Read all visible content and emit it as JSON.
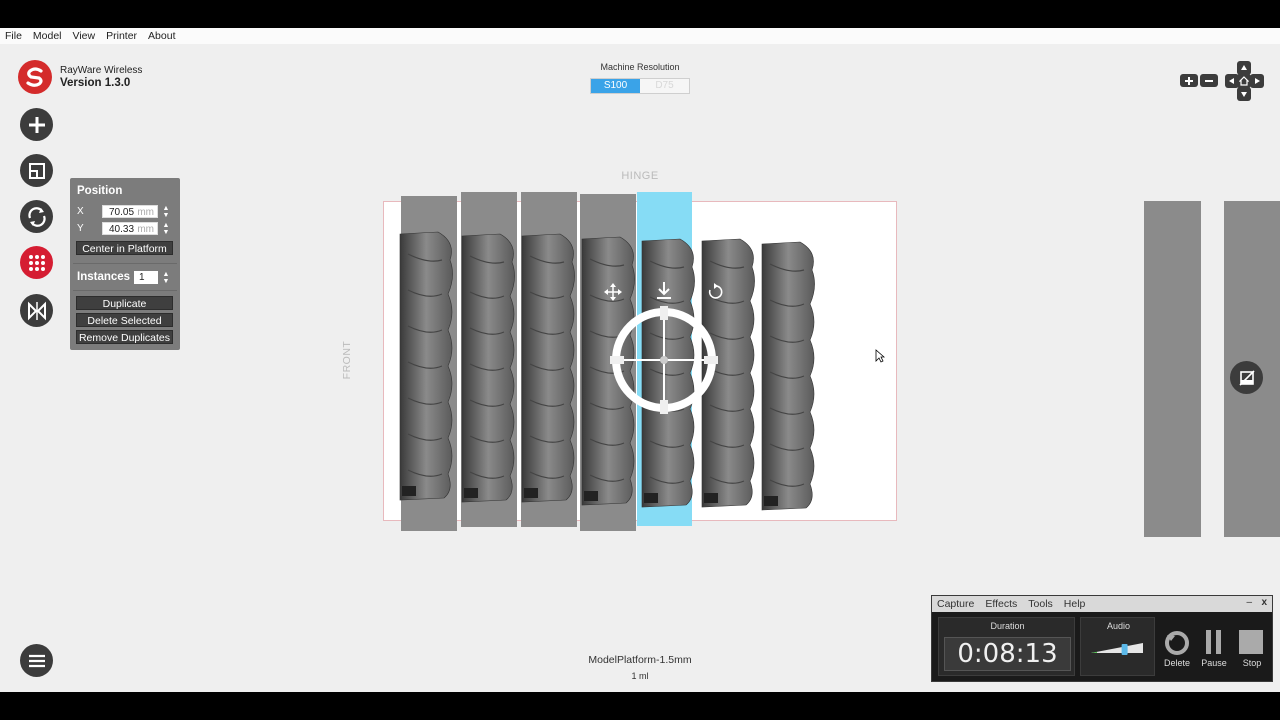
{
  "menu": [
    "File",
    "Model",
    "View",
    "Printer",
    "About"
  ],
  "brand": {
    "name": "RayWare Wireless",
    "version": "Version 1.3.0"
  },
  "resolution": {
    "label": "Machine Resolution",
    "options": [
      "S100",
      "D75"
    ],
    "selected": "S100"
  },
  "position_panel": {
    "title": "Position",
    "x_label": "X",
    "x_value": "70.05",
    "x_unit": "mm",
    "y_label": "Y",
    "y_value": "40.33",
    "y_unit": "mm",
    "center_label": "Center in Platform",
    "instances_label": "Instances",
    "instances_value": "1",
    "duplicate_label": "Duplicate",
    "delete_selected_label": "Delete Selected",
    "remove_duplicates_label": "Remove Duplicates"
  },
  "platform": {
    "hinge_label": "HINGE",
    "front_label": "FRONT",
    "name": "ModelPlatform-1.5mm",
    "volume": "1 ml"
  },
  "capture": {
    "menu": [
      "Capture",
      "Effects",
      "Tools",
      "Help"
    ],
    "minimize": "–",
    "close": "x",
    "duration_label": "Duration",
    "duration_value": "0:08:13",
    "audio_label": "Audio",
    "audio_level": 0.7,
    "delete_label": "Delete",
    "pause_label": "Pause",
    "stop_label": "Stop"
  },
  "colors": {
    "accent": "#3aa3e8",
    "brand": "#d42b2b",
    "selected_slot": "#86dcf5",
    "dark": "#3c3c3c"
  }
}
